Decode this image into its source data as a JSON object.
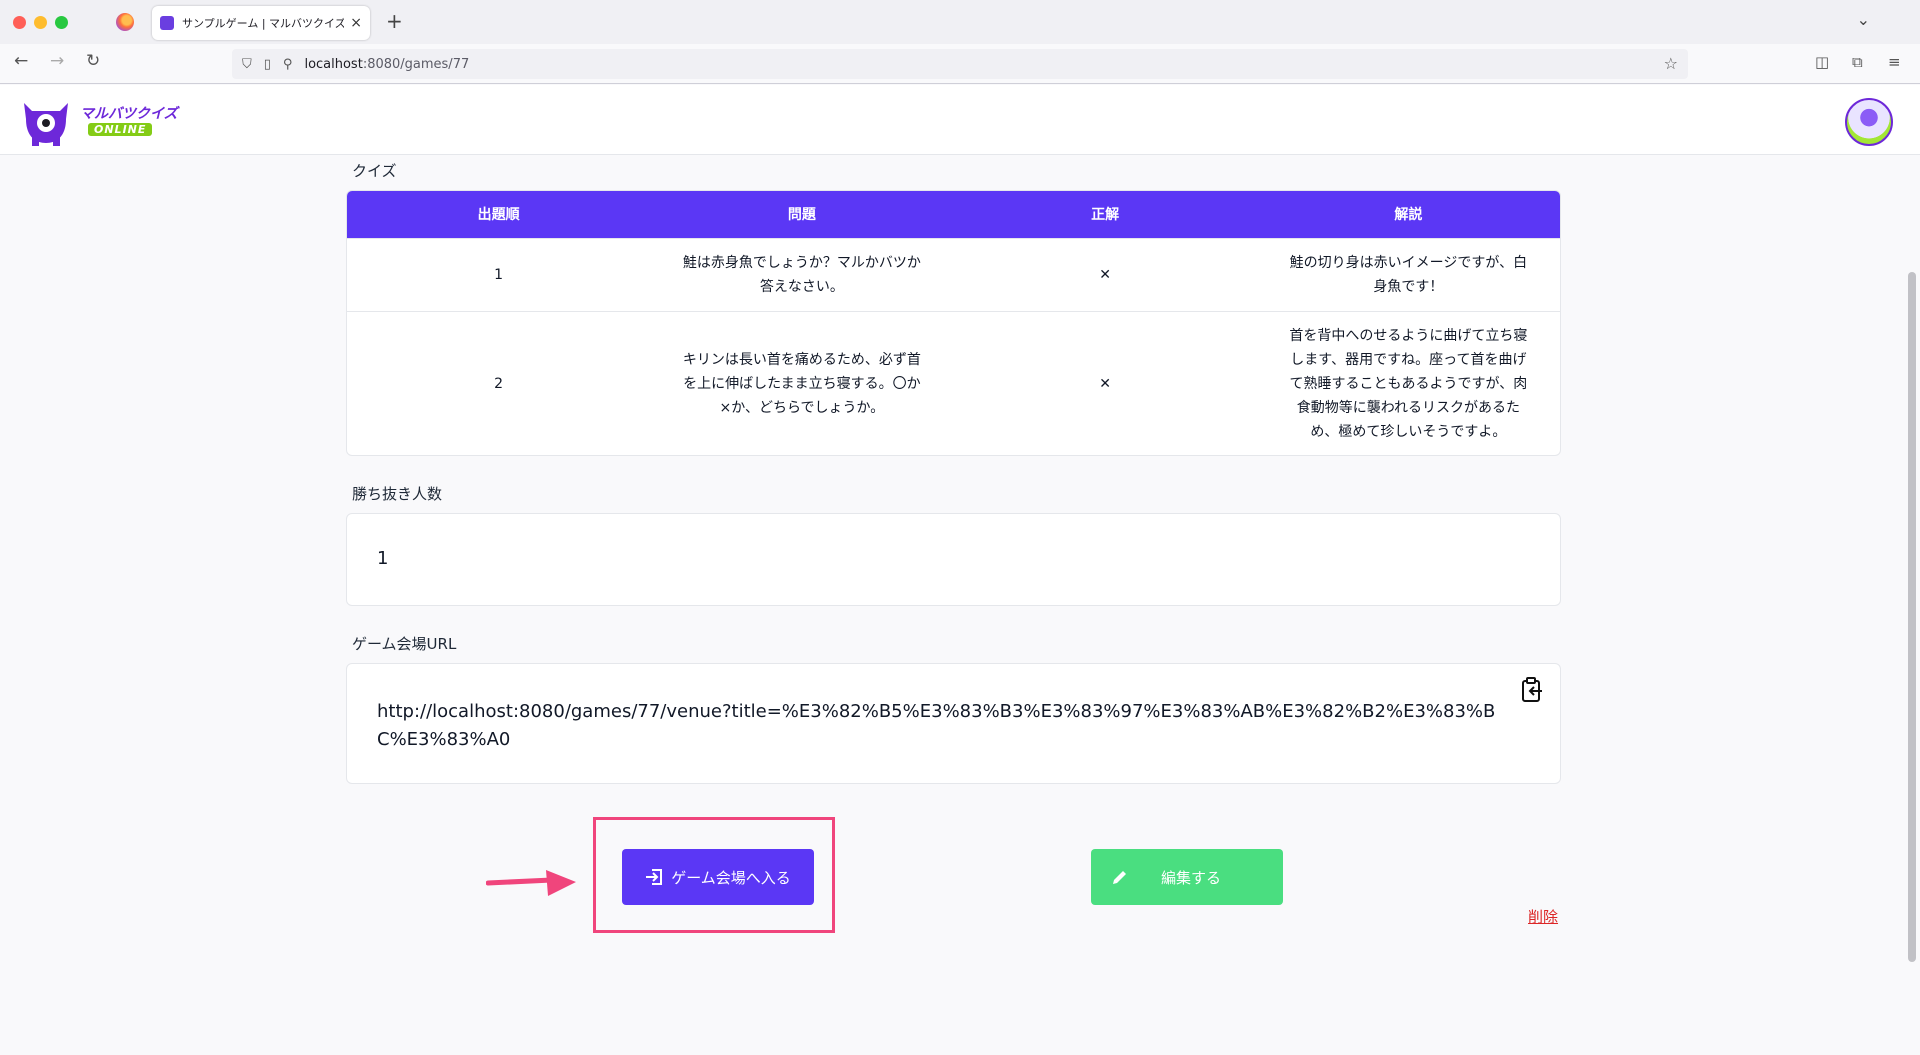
{
  "browser": {
    "tab_title": "サンプルゲーム | マルバツクイズ",
    "tab_close": "×",
    "new_tab": "+",
    "url_host": "localhost",
    "url_path": ":8080/games/77"
  },
  "site": {
    "logo_text": "マルバツクイズ",
    "logo_badge": "ONLINE"
  },
  "quiz": {
    "label": "クイズ",
    "headers": [
      "出題順",
      "問題",
      "正解",
      "解説"
    ],
    "rows": [
      {
        "order": "1",
        "question": "鮭は赤身魚でしょうか？マルかバツか答えなさい。",
        "answer": "✕",
        "explanation": "鮭の切り身は赤いイメージですが、白身魚です！"
      },
      {
        "order": "2",
        "question": "キリンは長い首を痛めるため、必ず首を上に伸ばしたまま立ち寝する。〇か×か、どちらでしょうか。",
        "answer": "✕",
        "explanation": "首を背中へのせるように曲げて立ち寝します、器用ですね。座って首を曲げて熟睡することもあるようですが、肉食動物等に襲われるリスクがあるため、極めて珍しいそうですよ。"
      }
    ]
  },
  "winners": {
    "label": "勝ち抜き人数",
    "value": "1"
  },
  "venue": {
    "label": "ゲーム会場URL",
    "url": "http://localhost:8080/games/77/venue?title=%E3%82%B5%E3%83%B3%E3%83%97%E3%83%AB%E3%82%B2%E3%83%BC%E3%83%A0"
  },
  "actions": {
    "enter_label": "ゲーム会場へ入る",
    "edit_label": "編集する",
    "delete_label": "削除"
  },
  "colors": {
    "primary": "#5b37f5",
    "edit": "#4ade80",
    "delete": "#dc2626",
    "highlight": "#f0457c"
  }
}
